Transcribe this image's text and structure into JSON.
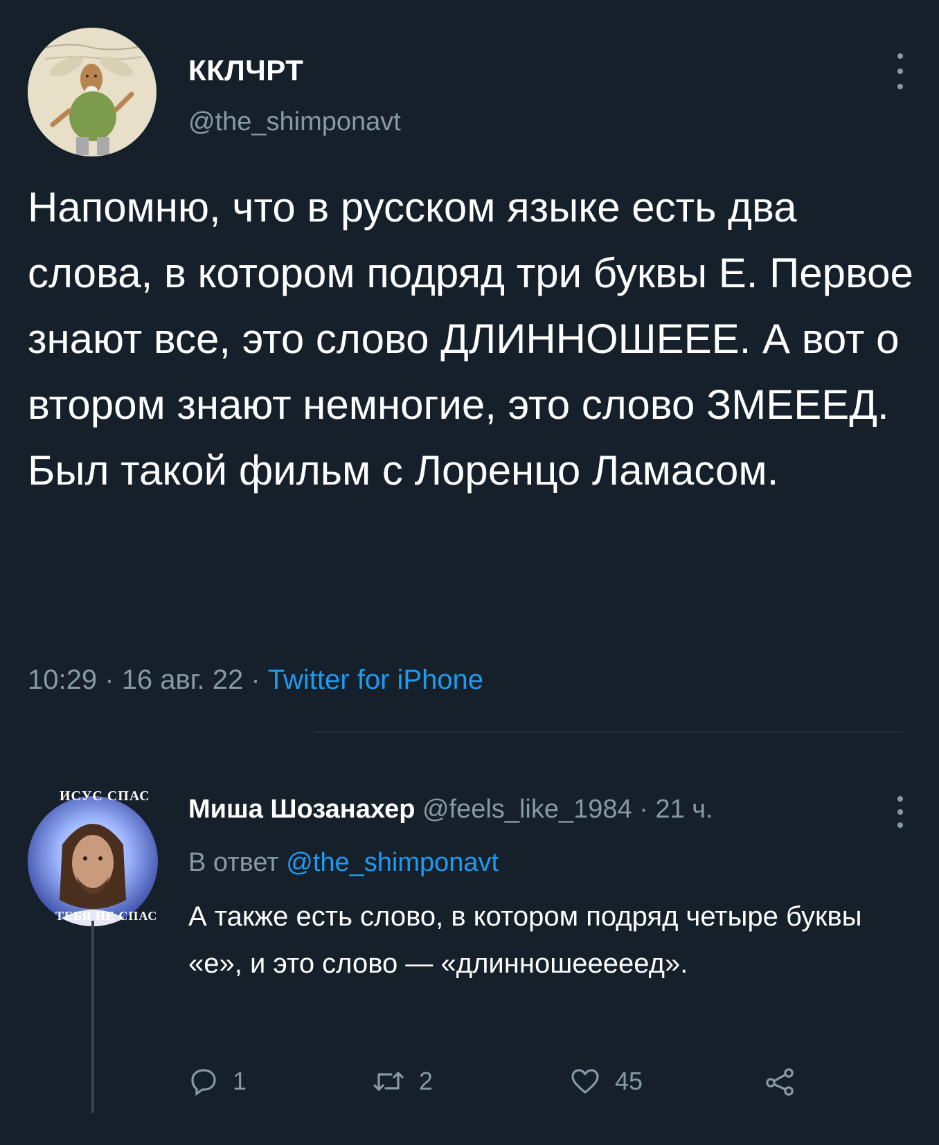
{
  "main_tweet": {
    "display_name": "ККЛЧРТ",
    "handle": "@the_shimponavt",
    "text": "Напомню, что в русском языке есть два слова, в котором подряд три буквы Е. Первое знают все, это слово ДЛИННОШЕЕЕ. А вот о втором знают немногие, это слово ЗМЕЕЕД. Был такой фильм с Лоренцо Ламасом.",
    "time": "10:29",
    "date": "16 авг. 22",
    "separator": "·",
    "source": "Twitter for iPhone"
  },
  "reply": {
    "display_name": "Миша Шозанахер",
    "handle": "@feels_like_1984",
    "separator": "·",
    "age": "21 ч.",
    "reply_prefix": "В ответ",
    "reply_to": "@the_shimponavt",
    "text": "А также есть слово, в котором подряд четыре буквы «е», и это слово — «длинношееееед».",
    "avatar_caption_top": "ИСУС СПАС",
    "avatar_caption_bottom": "ТЕБЯ НЕ СПАС",
    "actions": {
      "replies": "1",
      "retweets": "2",
      "likes": "45"
    }
  },
  "icons": {
    "more": "more-vertical-icon",
    "reply": "comment-icon",
    "retweet": "retweet-icon",
    "like": "heart-icon",
    "share": "share-icon"
  },
  "colors": {
    "background": "#15202b",
    "text": "#ffffff",
    "secondary": "#8899a6",
    "link": "#1d9bf0",
    "divider": "#38444d"
  }
}
